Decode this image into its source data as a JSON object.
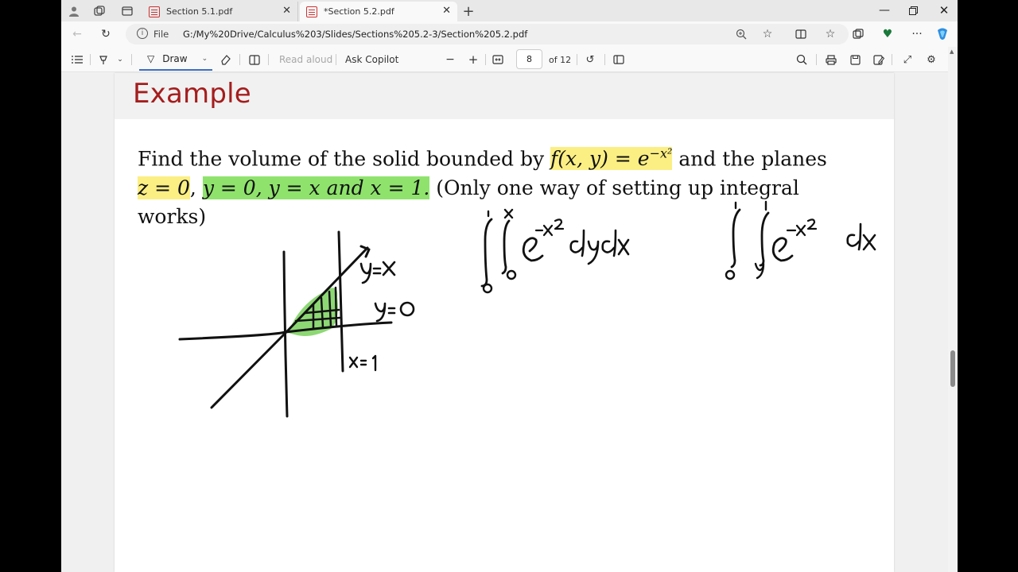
{
  "tabs": [
    {
      "title": "Section 5.1.pdf",
      "active": false
    },
    {
      "title": "*Section 5.2.pdf",
      "active": true
    }
  ],
  "address": {
    "scheme_label": "File",
    "url": "G:/My%20Drive/Calculus%203/Slides/Sections%205.2-3/Section%205.2.pdf"
  },
  "toolbar": {
    "draw_label": "Draw",
    "read_aloud_label": "Read aloud",
    "ask_copilot_label": "Ask Copilot",
    "page_current": "8",
    "page_total": "of 12"
  },
  "slide": {
    "title": "Example",
    "line1_a": "Find the volume of the solid bounded by ",
    "line1_hl": "f(x, y) = e",
    "line1_sup": "−x²",
    "line1_b": " and the planes",
    "line2_hl1": "z = 0",
    "line2_comma": ", ",
    "line2_hl2": "y = 0, y = x and x = 1.",
    "line2_b": " (Only one way of setting up integral",
    "line3": "works)"
  },
  "colors": {
    "title_red": "#a51d1d",
    "highlight_yellow": "#fbef84",
    "highlight_green": "#8fe36d",
    "accent_blue": "#3b6fc2"
  }
}
